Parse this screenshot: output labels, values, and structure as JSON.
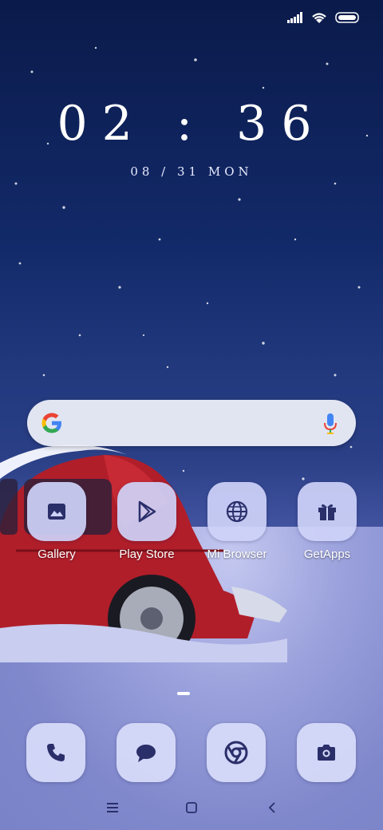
{
  "clock": {
    "time": "02 : 36",
    "date": "08 / 31  MON"
  },
  "search": {
    "placeholder": ""
  },
  "apps": [
    {
      "label": "Gallery",
      "icon": "gallery-icon"
    },
    {
      "label": "Play Store",
      "icon": "play-store-icon"
    },
    {
      "label": "Mi Browser",
      "icon": "globe-icon"
    },
    {
      "label": "GetApps",
      "icon": "gift-icon"
    }
  ],
  "dock": [
    {
      "icon": "phone-icon"
    },
    {
      "icon": "message-icon"
    },
    {
      "icon": "chrome-icon"
    },
    {
      "icon": "camera-icon"
    }
  ],
  "navbar": {
    "menu": "menu-icon",
    "home": "home-icon",
    "back": "back-icon"
  },
  "colors": {
    "icon_fill": "#2a2f6a",
    "tile_bg": "#ced3f8"
  }
}
